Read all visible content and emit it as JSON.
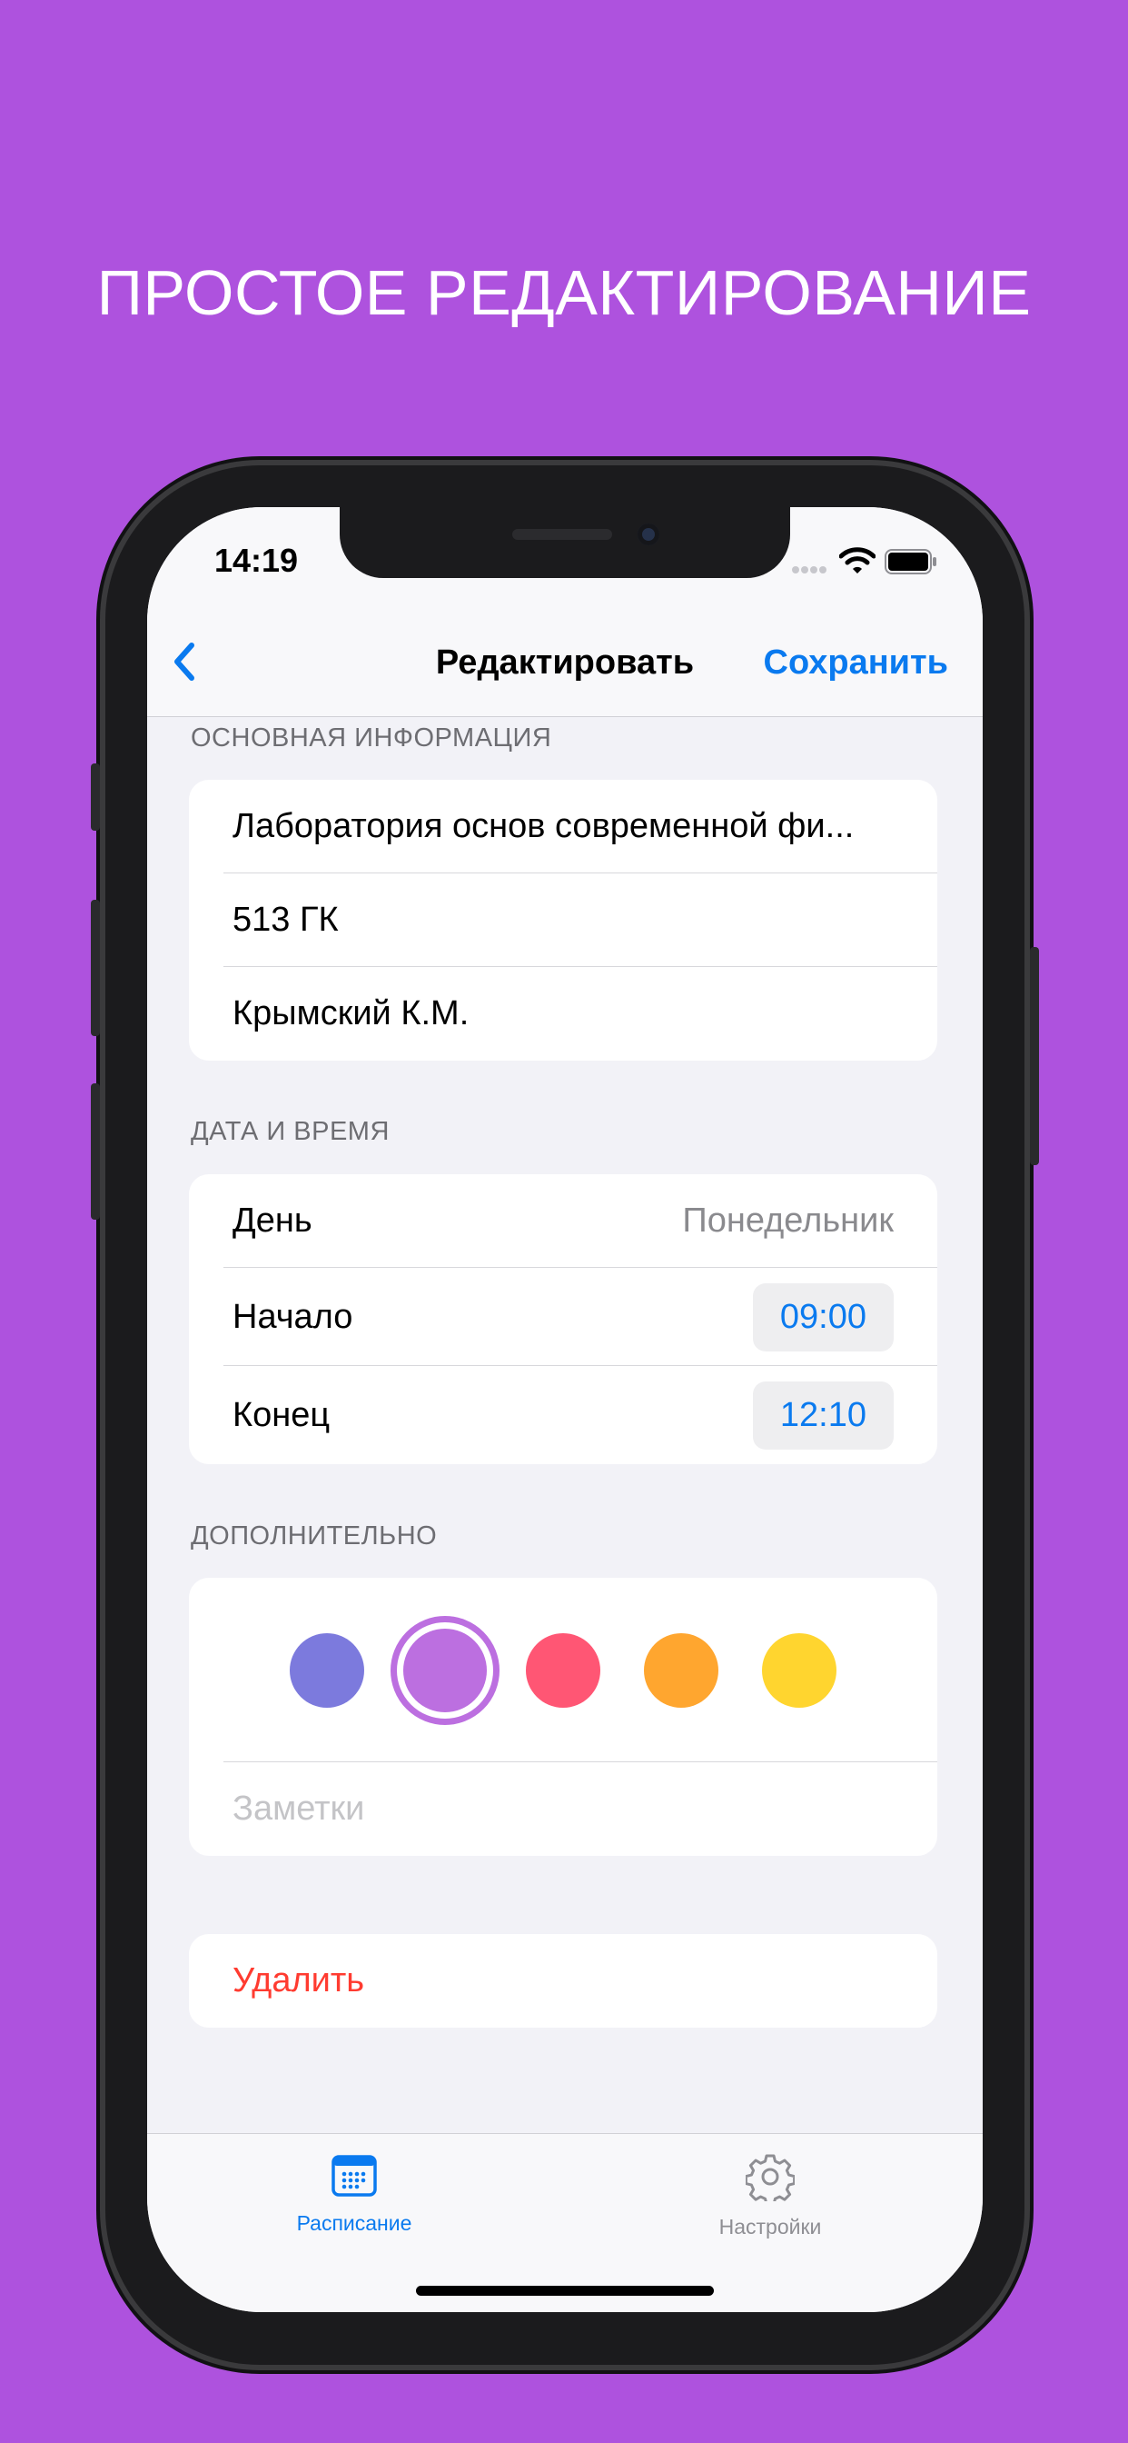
{
  "headline": "ПРОСТОЕ РЕДАКТИРОВАНИЕ",
  "status_bar": {
    "time": "14:19"
  },
  "nav": {
    "back_icon": "chevron-left-icon",
    "title": "Редактировать",
    "save_label": "Сохранить"
  },
  "basic_info": {
    "header": "ОСНОВНАЯ ИНФОРМАЦИЯ",
    "subject": "Лаборатория основ современной фи...",
    "room": "513 ГК",
    "teacher": "Крымский К.М."
  },
  "datetime": {
    "header": "ДАТА И ВРЕМЯ",
    "day_label": "День",
    "day_value": "Понедельник",
    "start_label": "Начало",
    "start_value": "09:00",
    "end_label": "Конец",
    "end_value": "12:10"
  },
  "extra": {
    "header": "ДОПОЛНИТЕЛЬНО",
    "colors": [
      "#7C7ADD",
      "#BC6FE0",
      "#FF5674",
      "#FFA62F",
      "#FFD52F"
    ],
    "selected_color_index": 1,
    "notes_placeholder": "Заметки"
  },
  "delete_label": "Удалить",
  "tabbar": {
    "tabs": [
      {
        "label": "Расписание",
        "icon": "calendar-icon",
        "active": true
      },
      {
        "label": "Настройки",
        "icon": "gear-icon",
        "active": false
      }
    ],
    "active_color": "#0A7AEF",
    "inactive_color": "#8E8E93"
  }
}
